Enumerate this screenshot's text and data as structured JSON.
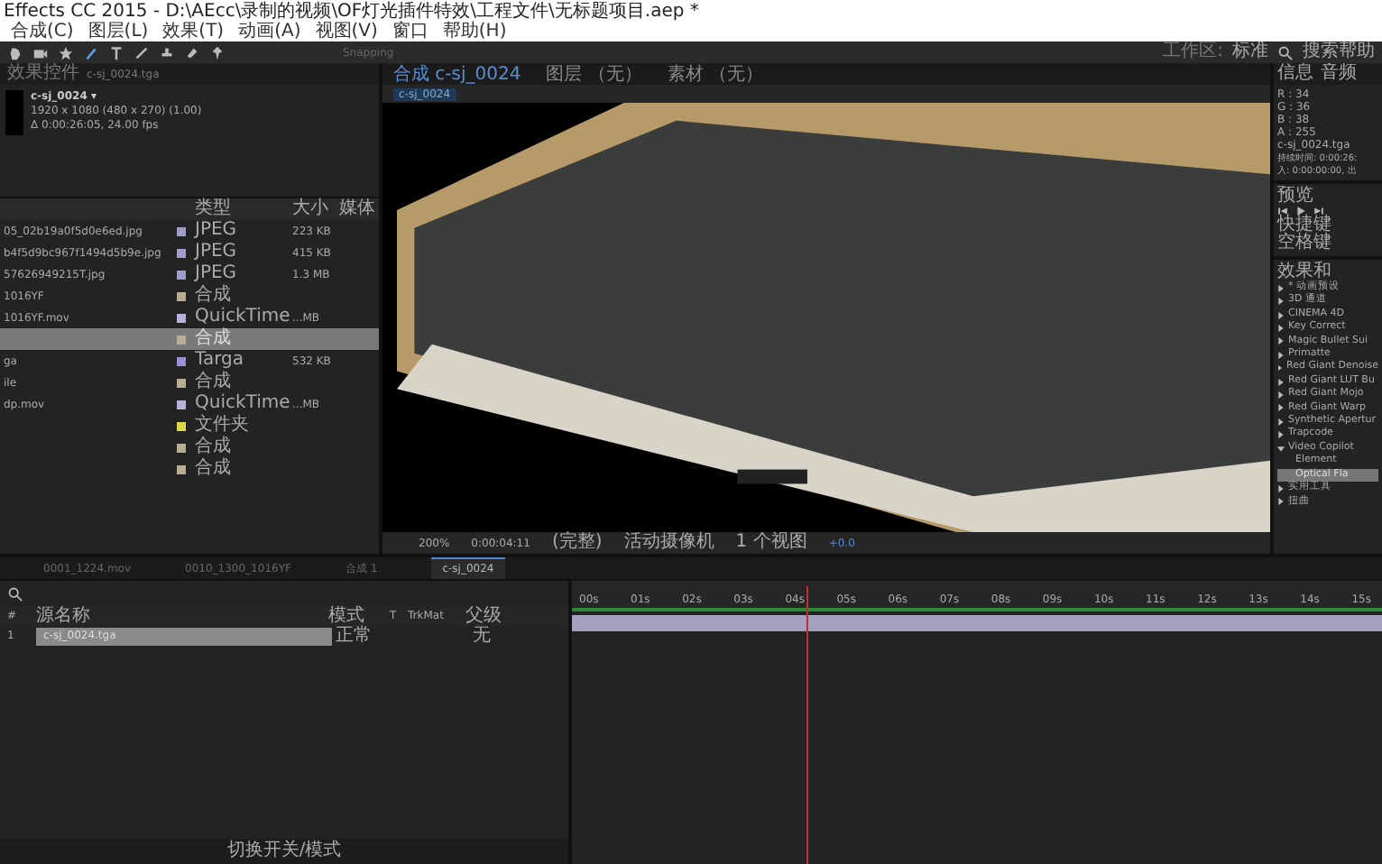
{
  "window": {
    "title": "Effects CC 2015 - D:\\AEcc\\录制的视频\\OF灯光插件特效\\工程文件\\无标题项目.aep *"
  },
  "menu": [
    "合成(C)",
    "图层(L)",
    "效果(T)",
    "动画(A)",
    "视图(V)",
    "窗口",
    "帮助(H)"
  ],
  "toolbar": {
    "snapping": "Snapping",
    "workspace_label": "工作区:",
    "workspace": "标准",
    "search": "搜索帮助"
  },
  "project": {
    "tab": "效果控件",
    "tab_file": "c-sj_0024.tga",
    "name": "c-sj_0024 ▾",
    "size": "1920 x 1080 (480 x 270) (1.00)",
    "duration": "Δ 0:00:26:05, 24.00 fps",
    "columns": [
      "类型",
      "大小",
      "媒体"
    ],
    "rows": [
      {
        "name": "05_02b19a0f5d0e6ed.jpg",
        "type": "JPEG",
        "size": "223 KB",
        "color": "#9e9ec8",
        "selected": false
      },
      {
        "name": "b4f5d9bc967f1494d5b9e.jpg",
        "type": "JPEG",
        "size": "415 KB",
        "color": "#9e9ec8",
        "selected": false
      },
      {
        "name": "57626949215T.jpg",
        "type": "JPEG",
        "size": "1.3 MB",
        "color": "#9e9ec8",
        "selected": false
      },
      {
        "name": "1016YF",
        "type": "合成",
        "size": "",
        "color": "#b8ad92",
        "selected": false
      },
      {
        "name": "1016YF.mov",
        "type": "QuickTime",
        "size": "...MB",
        "color": "#b3b3d9",
        "selected": false
      },
      {
        "name": "",
        "type": "合成",
        "size": "",
        "color": "#b8ad92",
        "selected": true
      },
      {
        "name": "ga",
        "type": "Targa",
        "size": "532 KB",
        "color": "#9a8fd0",
        "selected": false
      },
      {
        "name": "ile",
        "type": "合成",
        "size": "",
        "color": "#b8ad92",
        "selected": false
      },
      {
        "name": "dp.mov",
        "type": "QuickTime",
        "size": "...MB",
        "color": "#b3b3d9",
        "selected": false
      },
      {
        "name": "",
        "type": "文件夹",
        "size": "",
        "color": "#d8d84a",
        "selected": false
      },
      {
        "name": "",
        "type": "合成",
        "size": "",
        "color": "#b8ad92",
        "selected": false
      },
      {
        "name": "",
        "type": "合成",
        "size": "",
        "color": "#b8ad92",
        "selected": false
      }
    ]
  },
  "viewer": {
    "tabs": [
      {
        "label": "合成",
        "sub": "c-sj_0024",
        "selected": true
      },
      {
        "label": "图层",
        "sub": "（无）",
        "selected": false
      },
      {
        "label": "素材",
        "sub": "（无）",
        "selected": false
      }
    ],
    "comp_label": "c-sj_0024",
    "zoom": "200%",
    "time": "0:00:04:11",
    "resolution": "(完整)",
    "camera": "活动摄像机",
    "views": "1 个视图",
    "exposure": "+0.0"
  },
  "info": {
    "tabs": [
      "信息",
      "音频"
    ],
    "values": [
      "R : 34",
      "G : 36",
      "B : 38",
      "A : 255"
    ],
    "file": "c-sj_0024.tga",
    "duration": "持续时间: 0:00:26:",
    "in": "入: 0:00:00:00, 出"
  },
  "preview": {
    "title": "预览",
    "shortcut_label": "快捷键",
    "shortcut": "空格键"
  },
  "effects": {
    "title": "效果和",
    "items": [
      {
        "label": "* 动画预设",
        "expanded": false,
        "selected": false
      },
      {
        "label": "3D 通道",
        "expanded": false,
        "selected": false
      },
      {
        "label": "CINEMA 4D",
        "expanded": false,
        "selected": false
      },
      {
        "label": "Key Correct",
        "expanded": false,
        "selected": false
      },
      {
        "label": "Magic Bullet Sui",
        "expanded": false,
        "selected": false
      },
      {
        "label": "Primatte",
        "expanded": false,
        "selected": false
      },
      {
        "label": "Red Giant Denoise",
        "expanded": false,
        "selected": false
      },
      {
        "label": "Red Giant LUT Bu",
        "expanded": false,
        "selected": false
      },
      {
        "label": "Red Giant Mojo",
        "expanded": false,
        "selected": false
      },
      {
        "label": "Red Giant Warp",
        "expanded": false,
        "selected": false
      },
      {
        "label": "Synthetic Apertur",
        "expanded": false,
        "selected": false
      },
      {
        "label": "Trapcode",
        "expanded": false,
        "selected": false
      },
      {
        "label": "Video Copilot",
        "expanded": true,
        "selected": false,
        "children": [
          {
            "label": "Element",
            "selected": false
          },
          {
            "label": "Optical Fla",
            "selected": true
          }
        ]
      },
      {
        "label": "实用工具",
        "expanded": false,
        "selected": false
      },
      {
        "label": "扭曲",
        "expanded": false,
        "selected": false
      }
    ]
  },
  "timeline": {
    "tabs": [
      {
        "label": "0001_1224.mov",
        "selected": false
      },
      {
        "label": "0010_1300_1016YF",
        "selected": false
      },
      {
        "label": "合成 1",
        "selected": false
      },
      {
        "label": "c-sj_0024",
        "selected": true
      }
    ],
    "columns": [
      "#",
      "源名称",
      "模式",
      "T",
      "TrkMat",
      "父级"
    ],
    "layers": [
      {
        "index": "1",
        "name": "c-sj_0024.tga",
        "mode": "正常",
        "parent": "无",
        "selected": true
      }
    ],
    "ruler": [
      "00s",
      "01s",
      "02s",
      "03s",
      "04s",
      "05s",
      "06s",
      "07s",
      "08s",
      "09s",
      "10s",
      "11s",
      "12s",
      "13s",
      "14s",
      "15s"
    ],
    "footer": "切换开关/模式"
  }
}
